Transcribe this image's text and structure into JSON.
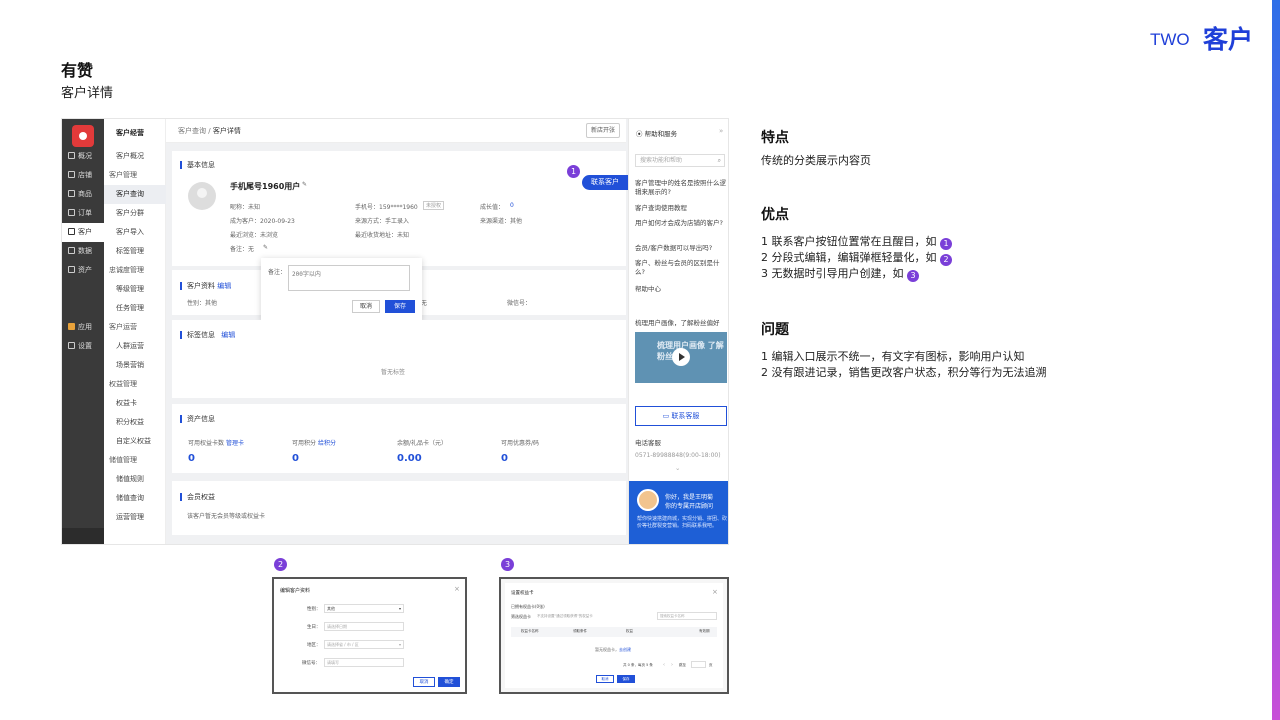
{
  "header": {
    "two": "TWO",
    "section": "客户",
    "brand": "有赞",
    "subtitle": "客户详情"
  },
  "colors": {
    "accent": "#2150d8",
    "badge": "#7a3fd8",
    "nav_dark": "#3a3a3a"
  },
  "nav1": [
    {
      "label": "概况",
      "icon": "dashboard-icon"
    },
    {
      "label": "店铺",
      "icon": "shop-icon"
    },
    {
      "label": "商品",
      "icon": "tag-icon"
    },
    {
      "label": "订单",
      "icon": "order-icon"
    },
    {
      "label": "客户",
      "icon": "user-icon"
    },
    {
      "label": "数据",
      "icon": "chart-icon"
    },
    {
      "label": "资产",
      "icon": "asset-icon"
    },
    {
      "label": "应用",
      "icon": "apps-icon"
    },
    {
      "label": "设置",
      "icon": "gear-icon"
    }
  ],
  "nav2": {
    "title": "客户经营",
    "items": [
      "客户概况",
      "客户管理",
      "客户查询",
      "客户分群",
      "客户导入",
      "标签管理",
      "忠诚度管理",
      "等级管理",
      "任务管理",
      "客户运营",
      "人群运营",
      "场景营销",
      "权益管理",
      "权益卡",
      "积分权益",
      "自定义权益",
      "储值管理",
      "储值规则",
      "储值查询",
      "运营管理"
    ]
  },
  "topbar": {
    "crumb1": "客户查询",
    "sep": "/",
    "crumb2": "客户详情",
    "new_store": "新店开张"
  },
  "basic": {
    "title": "基本信息",
    "name": "手机尾号1960用户",
    "contact_btn": "联系客户",
    "nickname": "昵称：未知",
    "phone": "手机号：159****1960",
    "unauth": "未授权",
    "growth": "成长值：",
    "growth_val": "0",
    "since": "成为客户：2020-09-23",
    "source": "来源方式：手工录入",
    "channel": "来源渠道：其他",
    "recent_view": "最近浏览：未浏览",
    "recent_addr": "最近收货地址：未知",
    "note": "备注：无"
  },
  "popup": {
    "label": "备注：",
    "placeholder": "200字以内",
    "cancel": "取消",
    "save": "保存"
  },
  "profile": {
    "title": "客户资料",
    "edit": "编辑",
    "gender": "性别：其他",
    "partial": "无",
    "wechat": "微信号："
  },
  "tags": {
    "title": "标签信息",
    "edit": "编辑",
    "empty": "暂无标签"
  },
  "assets": {
    "title": "资产信息",
    "items": [
      {
        "label": "可用权益卡数",
        "link": "管理卡",
        "value": "0"
      },
      {
        "label": "可用积分",
        "link": "给积分",
        "value": "0"
      },
      {
        "label": "余额/礼品卡（元）",
        "link": "",
        "value": "0.00"
      },
      {
        "label": "可用优惠券/码",
        "link": "",
        "value": "0"
      }
    ]
  },
  "member": {
    "title": "会员权益",
    "text": "该客户暂无会员等级或权益卡"
  },
  "help": {
    "title": "帮助和服务",
    "collapse": "»",
    "search_placeholder": "搜索功能和帮助",
    "questions": [
      "客户管理中的姓名是按照什么逻辑来展示的?",
      "客户查询使用教程",
      "用户如何才会成为店铺的客户?",
      "会员/客户数据可以导出吗?",
      "客户、粉丝与会员的区别是什么?"
    ],
    "help_center": "帮助中心",
    "video_title": "梳理用户画像，了解粉丝偏好",
    "video_text": "梳理用户画像 了解粉丝偏好",
    "service_btn": "联系客服",
    "phone_label": "电话客服",
    "phone": "0571-89988848(9:00-18:00)",
    "advisor_line1": "你好，我是王明菊",
    "advisor_line2": "你的专属开店顾问",
    "advisor_text": "帮你快速搭建商城，实现分销、拼团、砍价等社群裂变营销。扫码联系我吧。"
  },
  "badges": [
    "1",
    "2",
    "3"
  ],
  "dialog2": {
    "title": "编辑客户资料",
    "close": "×",
    "gender_label": "性别：",
    "gender_val": "其他",
    "birth_label": "生日：",
    "birth_ph": "请选择日期",
    "region_label": "地区：",
    "region_ph": "请选择省 / 市 / 区",
    "wechat_label": "微信号：",
    "wechat_ph": "请填写",
    "cancel": "取消",
    "ok": "确定"
  },
  "dialog3": {
    "title": "设置权益卡",
    "close": "×",
    "selected": "已拥有权益卡(0张)",
    "filter_label": "筛选权益卡",
    "filter_hint": "不支持设置\"通过领取获得\"的权益卡",
    "search_ph": "搜索权益卡名称",
    "cols": [
      "权益卡名称",
      "领取条件",
      "权益",
      "有效期"
    ],
    "empty": "暂无权益卡，",
    "create": "去创建",
    "pager": "共 0 条，每页 5 条",
    "jump": "跳至",
    "page": "页",
    "cancel": "取消",
    "ok": "保存"
  },
  "right": {
    "feature_title": "特点",
    "feature_text": "传统的分类展示内容页",
    "pros_title": "优点",
    "pros": [
      "1  联系客户按钮位置常在且醒目，如",
      "2 分段式编辑，编辑弹框轻量化，如",
      "3 无数据时引导用户创建，如"
    ],
    "cons_title": "问题",
    "cons": [
      "1 编辑入口展示不统一，有文字有图标，影响用户认知",
      "2 没有跟进记录，销售更改客户状态，积分等行为无法追溯"
    ]
  }
}
